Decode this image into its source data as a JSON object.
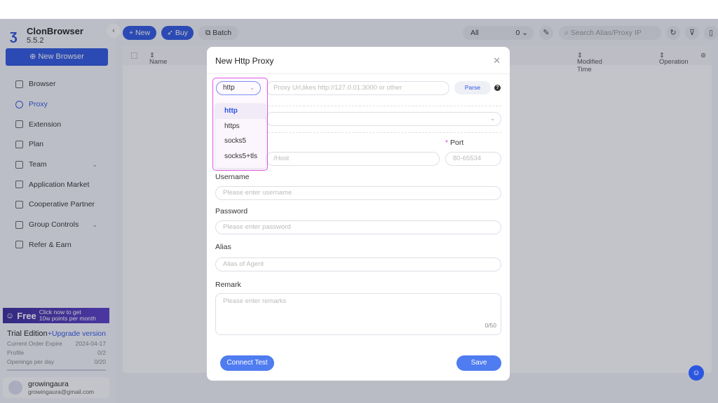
{
  "app": {
    "name": "ClonBrowser",
    "version": "5.5.2"
  },
  "sidebar": {
    "new_browser": "New Browser",
    "items": [
      {
        "label": "Browser"
      },
      {
        "label": "Proxy",
        "active": true
      },
      {
        "label": "Extension"
      },
      {
        "label": "Plan"
      },
      {
        "label": "Team",
        "chevron": true
      },
      {
        "label": "Application Market"
      },
      {
        "label": "Cooperative Partner"
      },
      {
        "label": "Group Controls",
        "chevron": true
      },
      {
        "label": "Refer & Earn"
      }
    ]
  },
  "promo": {
    "free": "Free",
    "line1": "Click now to get",
    "line2": "10w points per month"
  },
  "trial": {
    "edition": "Trial Edition",
    "upgrade": "+Upgrade version",
    "rows": [
      {
        "label": "Current Order Expire",
        "value": "2024-04-17"
      },
      {
        "label": "Profile",
        "value": "0/2"
      },
      {
        "label": "Openings per day",
        "value": "0/20"
      }
    ]
  },
  "user": {
    "name": "growingaura",
    "email": "growingaura@gmail.com"
  },
  "toolbar": {
    "new": "+ New",
    "buy": "Buy",
    "batch": "Batch",
    "filter_value": "All",
    "filter_count": "0",
    "search_placeholder": "Search Alias/Proxy IP"
  },
  "table": {
    "columns": [
      "Name",
      "Modified Time",
      "Operation"
    ]
  },
  "modal": {
    "title": "New Http Proxy",
    "protocol": "http",
    "protocol_options": [
      "http",
      "https",
      "socks5",
      "socks5+tls"
    ],
    "proxy_url_placeholder": "Proxy Url,likes http://127.0.01:3000 or other",
    "parse": "Parse",
    "host_placeholder": "/Host",
    "port_label": "Port",
    "port_placeholder": "80-65534",
    "username_label": "Username",
    "username_placeholder": "Please enter username",
    "password_label": "Password",
    "password_placeholder": "Please enter password",
    "alias_label": "Alias",
    "alias_placeholder": "Alias of Agent",
    "remark_label": "Remark",
    "remark_placeholder": "Please enter remarks",
    "remark_count": "0/50",
    "connect_test": "Connect Test",
    "save": "Save"
  },
  "colors": {
    "accent": "#2d56e0",
    "highlight": "#e05ce0"
  }
}
